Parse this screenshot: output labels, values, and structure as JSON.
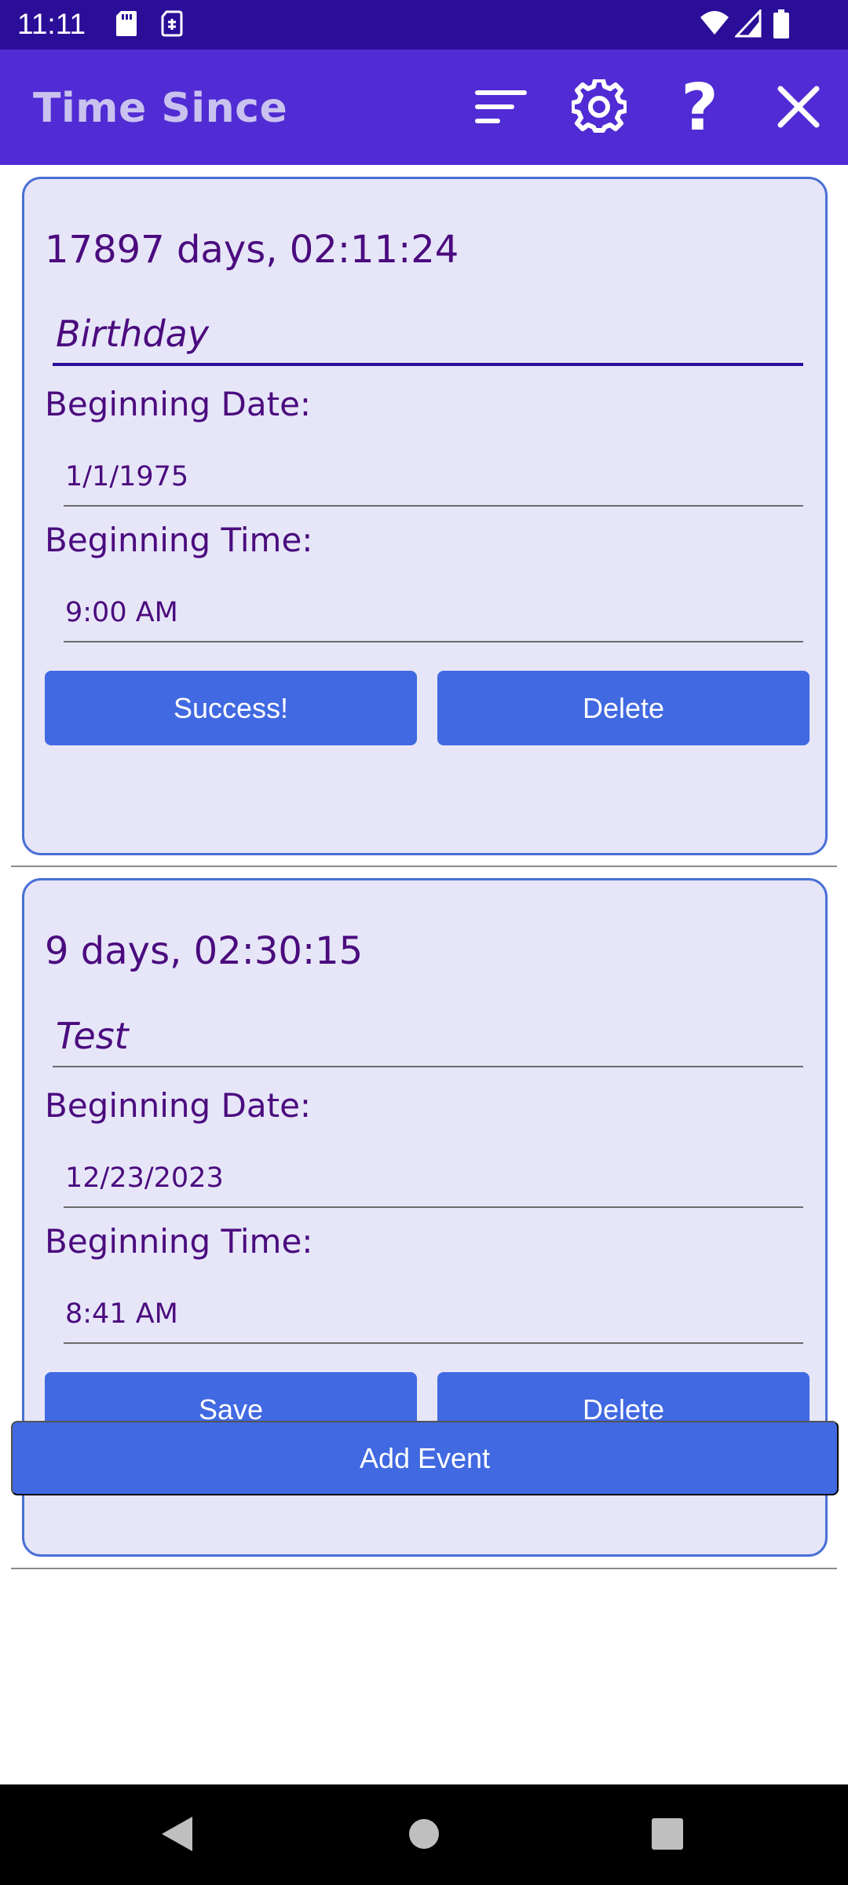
{
  "status_bar": {
    "time": "11:11",
    "left_icons": [
      "sd-card-icon",
      "sim-icon"
    ],
    "right_icons": [
      "wifi-icon",
      "signal-icon",
      "battery-icon"
    ]
  },
  "app_bar": {
    "title": "Time Since",
    "actions": [
      {
        "name": "sort",
        "icon": "sort-icon"
      },
      {
        "name": "settings",
        "icon": "gear-icon"
      },
      {
        "name": "help",
        "icon": "question-icon"
      },
      {
        "name": "close",
        "icon": "close-icon"
      }
    ]
  },
  "events": [
    {
      "elapsed": "17897 days, 02:11:24",
      "name": "Birthday",
      "date_label": "Beginning Date:",
      "date_value": "1/1/1975",
      "time_label": "Beginning Time:",
      "time_value": "9:00 AM",
      "primary_button": "Success!",
      "delete_button": "Delete"
    },
    {
      "elapsed": "9 days, 02:30:15",
      "name": "Test",
      "date_label": "Beginning Date:",
      "date_value": "12/23/2023",
      "time_label": "Beginning Time:",
      "time_value": "8:41 AM",
      "primary_button": "Save",
      "delete_button": "Delete"
    }
  ],
  "add_event_label": "Add Event",
  "colors": {
    "status_bar": "#2a0e98",
    "app_bar": "#512bd4",
    "card_bg": "#e6e6f8",
    "text_purple": "#4b0b7e",
    "button_blue": "#4169e1"
  },
  "nav_bar": {
    "icons": [
      "back-icon",
      "home-icon",
      "recents-icon"
    ]
  }
}
